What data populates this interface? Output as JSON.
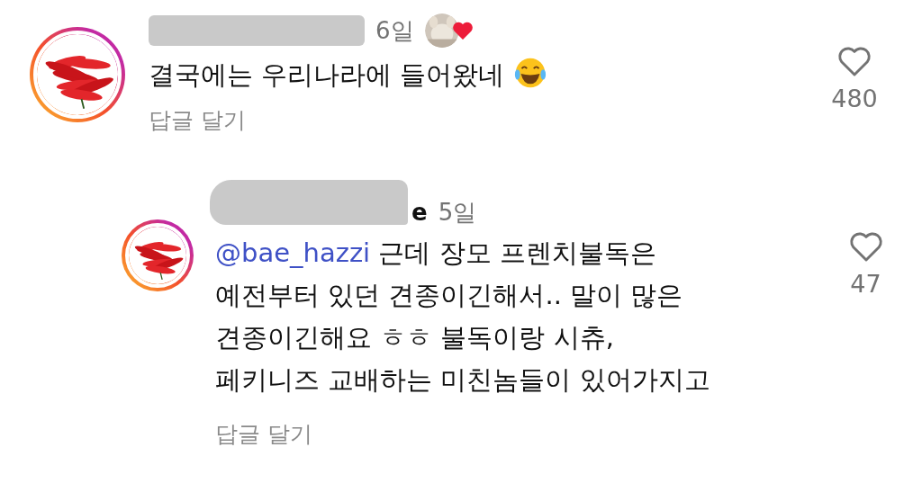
{
  "comments": [
    {
      "username_redacted": true,
      "time": "6일",
      "liked_by_author": true,
      "text": "결국에는 우리나라에 들어왔네",
      "emoji": true,
      "reply_label": "답글 달기",
      "liked": false,
      "like_count": "480",
      "kind": "comment"
    },
    {
      "username": "e",
      "username_redacted": true,
      "time": "5일",
      "liked_by_author": false,
      "mention": "@bae_hazzi",
      "text": "근데 장모 프렌치불독은\n예전부터 있던 견종이긴해서.. 말이 많은\n견종이긴해요 ㅎㅎ 불독이랑 시츄,\n페키니즈 교배하는 미친놈들이 있어가지고",
      "emoji": false,
      "reply_label": "답글 달기",
      "liked": false,
      "like_count": "47",
      "kind": "reply"
    }
  ]
}
